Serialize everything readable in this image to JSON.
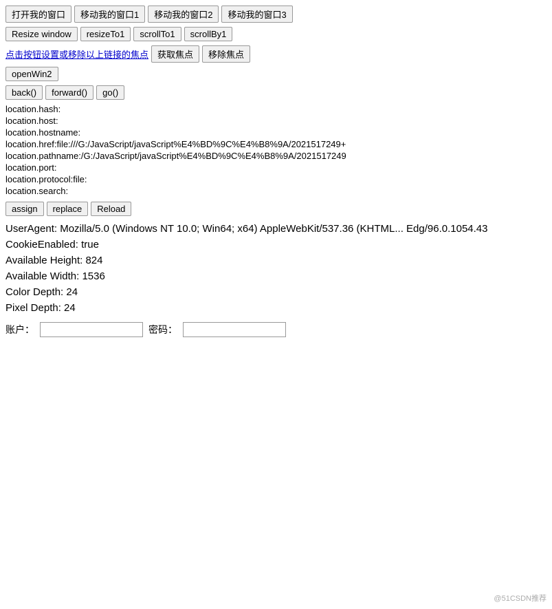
{
  "buttons_row1": {
    "btn1": "打开我的窗口",
    "btn2": "移动我的窗口1",
    "btn3": "移动我的窗口2",
    "btn4": "移动我的窗口3"
  },
  "buttons_row2": {
    "btn1": "Resize window",
    "btn2": "resizeTo1",
    "btn3": "scrollTo1",
    "btn4": "scrollBy1"
  },
  "link_text": "点击按钮设置或移除以上链接的焦点",
  "buttons_row3": {
    "btn1": "获取焦点",
    "btn2": "移除焦点"
  },
  "openwin_btn": "openWin2",
  "buttons_row4": {
    "btn1": "back()",
    "btn2": "forward()",
    "btn3": "go()"
  },
  "location": {
    "hash_label": "location.hash:",
    "hash_value": "",
    "host_label": "location.host:",
    "host_value": "",
    "hostname_label": "location.hostname:",
    "hostname_value": "",
    "href_label": "location.href:",
    "href_value": "file:///G:/JavaScript/javaScript%E4%BD%9C%E4%B8%9A/2021517249+",
    "pathname_label": "location.pathname:",
    "pathname_value": "/G:/JavaScript/javaScript%E4%BD%9C%E4%B8%9A/2021517249",
    "port_label": "location.port:",
    "port_value": "",
    "protocol_label": "location.protocol:",
    "protocol_value": "file:",
    "search_label": "location.search:",
    "search_value": ""
  },
  "buttons_row5": {
    "btn1": "assign",
    "btn2": "replace",
    "btn3": "Reload"
  },
  "useragent_label": "UserAgent:",
  "useragent_value": "Mozilla/5.0 (Windows NT 10.0; Win64; x64) AppleWebKit/537.36 (KHTML... Edg/96.0.1054.43",
  "cookie_label": "CookieEnabled:",
  "cookie_value": "true",
  "avail_height_label": "Available Height:",
  "avail_height_value": "824",
  "avail_width_label": "Available Width:",
  "avail_width_value": "1536",
  "color_depth_label": "Color Depth:",
  "color_depth_value": "24",
  "pixel_depth_label": "Pixel Depth:",
  "pixel_depth_value": "24",
  "account_label": "账户：",
  "password_label": "密码：",
  "account_placeholder": "",
  "password_placeholder": "",
  "watermark": "@51CSDN推荐"
}
